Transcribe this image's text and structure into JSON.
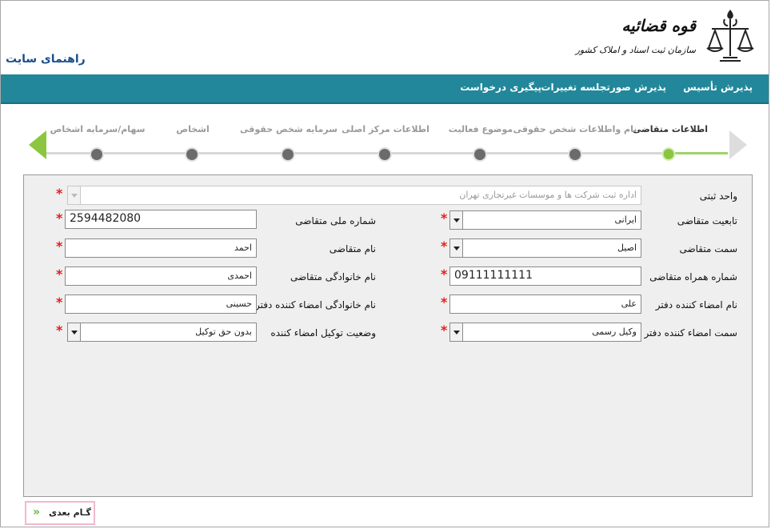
{
  "header": {
    "site_guide": "راهنمای سایت",
    "logo_line1": "قوه قضائیه",
    "logo_line2": "سازمان ثبت اسناد و املاک کشور"
  },
  "nav": {
    "items": [
      {
        "label": "پذیرش تأسیس"
      },
      {
        "label": "پذیرش صورتجلسه تغییرات"
      },
      {
        "label": "پیگیری درخواست"
      }
    ]
  },
  "wizard": {
    "steps": [
      {
        "label": "اطلاعات متقاضی",
        "active": true
      },
      {
        "label": "نام واطلاعات شخص حقوقی",
        "active": false
      },
      {
        "label": "موضوع فعالیت",
        "active": false
      },
      {
        "label": "اطلاعات مرکز اصلی",
        "active": false
      },
      {
        "label": "سرمایه شخص حقوقی",
        "active": false
      },
      {
        "label": "اشخاص",
        "active": false
      },
      {
        "label": "سهام/سرمایه اشخاص",
        "active": false
      }
    ]
  },
  "form": {
    "registry_unit": {
      "label": "واحد ثبتی",
      "value": "اداره ثبت شرکت ها و موسسات غیرتجاری تهران"
    },
    "nationality": {
      "label": "تابعیت متقاضی",
      "value": "ایرانی"
    },
    "national_id": {
      "label": "شماره ملی متقاضی",
      "value": "2594482080"
    },
    "role": {
      "label": "سمت متقاضی",
      "value": "اصیل"
    },
    "first_name": {
      "label": "نام متقاضی",
      "value": "احمد"
    },
    "mobile": {
      "label": "شماره همراه متقاضی",
      "value": "09111111111"
    },
    "last_name": {
      "label": "نام خانوادگی متقاضی",
      "value": "احمدی"
    },
    "signer_first_name": {
      "label": "نام امضاء کننده دفتر",
      "value": "علی"
    },
    "signer_last_name": {
      "label": "نام خانوادگی امضاء کننده دفتر",
      "value": "حسینی"
    },
    "signer_role": {
      "label": "سمت امضاء کننده دفتر",
      "value": "وکیل رسمی"
    },
    "proxy_status": {
      "label": "وضعیت توکیل امضاء کننده",
      "value": "بدون حق توکیل"
    },
    "required_mark": "*"
  },
  "footer": {
    "next_label": "گـام بعدی",
    "next_chevron": "»"
  }
}
